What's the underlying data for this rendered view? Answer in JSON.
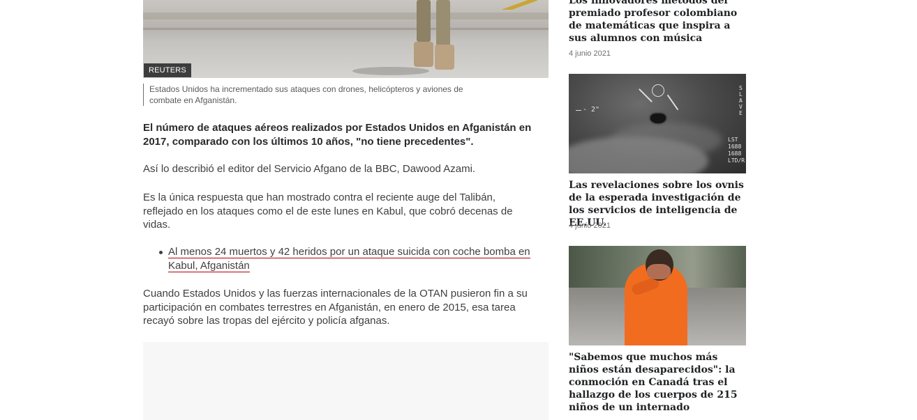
{
  "article": {
    "hero_credit": "REUTERS",
    "caption": "Estados Unidos ha incrementado sus ataques con drones, helicópteros y aviones de combate en Afganistán.",
    "lead": "El número de ataques aéreos realizados por Estados Unidos en Afganistán en 2017, comparado con los últimos 10 años, \"no tiene precedentes\".",
    "p1": "Así lo describió el editor del Servicio Afgano de la BBC, Dawood Azami.",
    "p2": "Es la única respuesta que han mostrado contra el reciente auge del Talibán, reflejado en los ataques como el de este lunes en Kabul, que cobró decenas de vidas.",
    "related_link": "Al menos 24 muertos y 42 heridos por un ataque suicida con coche bomba en Kabul, Afganistán",
    "p3": "Cuando Estados Unidos y las fuerzas internacionales de la OTAN pusieron fin a su participación en combates terrestres en Afganistán, en enero de 2015, esa tarea recayó sobre las tropas del ejército y policía afganas."
  },
  "sidebar": {
    "items": [
      {
        "title": "Los innovadores métodos del premiado profesor colombiano de matemáticas que inspira a sus alumnos con música",
        "date": "4 junio 2021"
      },
      {
        "title": "Las revelaciones sobre los ovnis de la esperada investigación de los servicios de inteligencia de EE.UU.",
        "date": "4 junio 2021",
        "hud_left": "- 2\"",
        "hud_right_top": "S\nL\nA\nV\nE",
        "hud_right_bottom": "LST\n1688\n1688\nLTD/R"
      },
      {
        "title": "\"Sabemos que muchos más niños están desaparecidos\": la conmoción en Canadá tras el hallazgo de los cuerpos de 215 niños de un internado"
      }
    ]
  },
  "colors": {
    "text": "#3f3f42",
    "link_underline": "#b80000",
    "credit_bg": "#3d3d3d"
  }
}
